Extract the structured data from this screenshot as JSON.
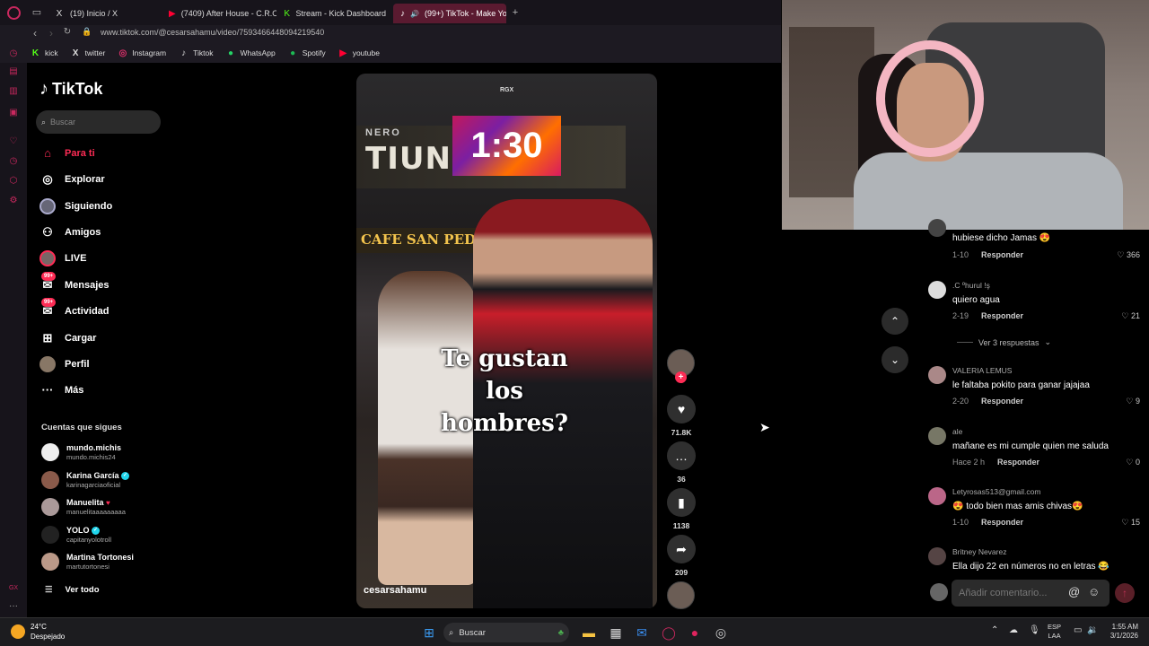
{
  "browser": {
    "tabs": [
      {
        "icon": "X",
        "label": "(19) Inicio / X",
        "color": "#ffffff"
      },
      {
        "icon": "▶",
        "label": "(7409) After House - C.R.O",
        "color": "#ff0033"
      },
      {
        "icon": "K",
        "label": "Stream - Kick Dashboard",
        "color": "#53fc18"
      },
      {
        "icon": "♪",
        "label": "(99+) TikTok - Make Yo",
        "color": "#ffffff"
      }
    ],
    "url": "www.tiktok.com/@cesarsahamu/video/7593466448094219540",
    "bookmarks": [
      {
        "icon": "K",
        "label": "kick",
        "color": "#53fc18"
      },
      {
        "icon": "X",
        "label": "twitter",
        "color": "#ffffff"
      },
      {
        "icon": "◎",
        "label": "Instagram",
        "color": "#e1306c"
      },
      {
        "icon": "♪",
        "label": "Tiktok",
        "color": "#ffffff"
      },
      {
        "icon": "●",
        "label": "WhatsApp",
        "color": "#25d366"
      },
      {
        "icon": "●",
        "label": "Spotify",
        "color": "#1db954"
      },
      {
        "icon": "▶",
        "label": "youtube",
        "color": "#ff0033"
      }
    ]
  },
  "tiktok": {
    "logo": "TikTok",
    "search_placeholder": "Buscar",
    "nav": [
      {
        "label": "Para ti",
        "icon": "⌂",
        "active": true
      },
      {
        "label": "Explorar",
        "icon": "◎"
      },
      {
        "label": "Siguiendo",
        "icon": "●"
      },
      {
        "label": "Amigos",
        "icon": "⚇"
      },
      {
        "label": "LIVE",
        "icon": "●"
      },
      {
        "label": "Mensajes",
        "icon": "✉",
        "badge": "99+"
      },
      {
        "label": "Actividad",
        "icon": "✉",
        "badge": "99+"
      },
      {
        "label": "Cargar",
        "icon": "⊞"
      },
      {
        "label": "Perfil",
        "icon": "●"
      },
      {
        "label": "Más",
        "icon": "···"
      }
    ],
    "following_header": "Cuentas que sigues",
    "following": [
      {
        "name": "mundo.michis",
        "user": "mundo.michis24"
      },
      {
        "name": "Karina García",
        "user": "karinagarciaofi­cial",
        "verified": true
      },
      {
        "name": "Manuelita",
        "user": "manuelitaaaaaaaaa"
      },
      {
        "name": "YOLO",
        "user": "capitanyolotroll",
        "verified": true
      },
      {
        "name": "Martina Tortonesi",
        "user": "martutortonesi"
      }
    ],
    "see_all": "Ver todo"
  },
  "video": {
    "watermark": "RGX",
    "sign_top": "NERO",
    "sign_main": "TIUNO",
    "timer": "1:30",
    "cafe_sign": "CAFE SAN PEDRO",
    "overlay_lines": [
      "Te gustan",
      "los",
      "hombres?"
    ],
    "author": "cesarsahamu"
  },
  "actions": {
    "likes": "71.8K",
    "comments": "36",
    "saves": "1138",
    "shares": "209"
  },
  "comments": [
    {
      "name": "",
      "text": "hubiese dicho Jamas 😍",
      "time": "1-10",
      "reply": "Responder",
      "likes": "366"
    },
    {
      "name": ".C ºhurul !ş",
      "text": "quiero agua",
      "time": "2-19",
      "reply": "Responder",
      "likes": "21"
    },
    {
      "name": "VALERIA LEMUS",
      "text": "le faltaba pokito para ganar jajajaa",
      "time": "2-20",
      "reply": "Responder",
      "likes": "9"
    },
    {
      "name": "ale",
      "text": "mañane es mi cumple quien me saluda",
      "time": "Hace 2 h",
      "reply": "Responder",
      "likes": "0"
    },
    {
      "name": "Letyrosas513@gmail.com",
      "text": "😍 todo bien mas amis chivas😍",
      "time": "1-10",
      "reply": "Responder",
      "likes": "15"
    },
    {
      "name": "Britney Nevarez",
      "text": "Ella dijo 22 en números no en letras 😂",
      "time": "",
      "reply": "",
      "likes": ""
    }
  ],
  "more_replies": "Ver 3 respuestas",
  "comment_placeholder": "Añadir comentario...",
  "taskbar": {
    "temp": "24°C",
    "weather": "Despejado",
    "search": "Buscar",
    "lang1": "ESP",
    "lang2": "LAA",
    "time": "1:55 AM",
    "date": "3/1/2026"
  }
}
